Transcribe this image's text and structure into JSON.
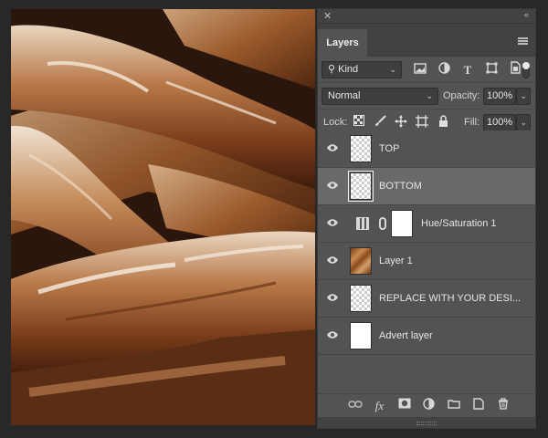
{
  "panel": {
    "close_glyph": "✕",
    "collapse_glyph": "‹‹",
    "tab_label": "Layers",
    "menu_icon": "panel-menu-icon"
  },
  "filter": {
    "kind_label": "Kind",
    "icons": [
      "image-filter-icon",
      "adjustment-filter-icon",
      "type-filter-icon",
      "shape-filter-icon",
      "smart-object-filter-icon"
    ]
  },
  "blend": {
    "mode": "Normal",
    "opacity_label": "Opacity:",
    "opacity_value": "100%"
  },
  "lock": {
    "label": "Lock:",
    "fill_label": "Fill:",
    "fill_value": "100%",
    "icons": [
      "lock-transparent-pixels-icon",
      "lock-image-pixels-icon",
      "lock-position-icon",
      "lock-artboard-icon",
      "lock-all-icon"
    ]
  },
  "layers": [
    {
      "name": "TOP",
      "thumb": "transparent",
      "selected": false
    },
    {
      "name": "BOTTOM",
      "thumb": "transparent",
      "selected": true
    },
    {
      "name": "Hue/Saturation 1",
      "thumb": "adjustment",
      "selected": false
    },
    {
      "name": "Layer 1",
      "thumb": "bread",
      "selected": false
    },
    {
      "name": "REPLACE WITH YOUR DESI...",
      "thumb": "transparent",
      "selected": false
    },
    {
      "name": "Advert layer",
      "thumb": "white",
      "selected": false
    }
  ],
  "bottom_icons": [
    "link-layers-icon",
    "fx-icon",
    "add-mask-icon",
    "new-adjustment-icon",
    "new-group-icon",
    "new-layer-icon",
    "delete-layer-icon"
  ],
  "fx_label": "fx"
}
